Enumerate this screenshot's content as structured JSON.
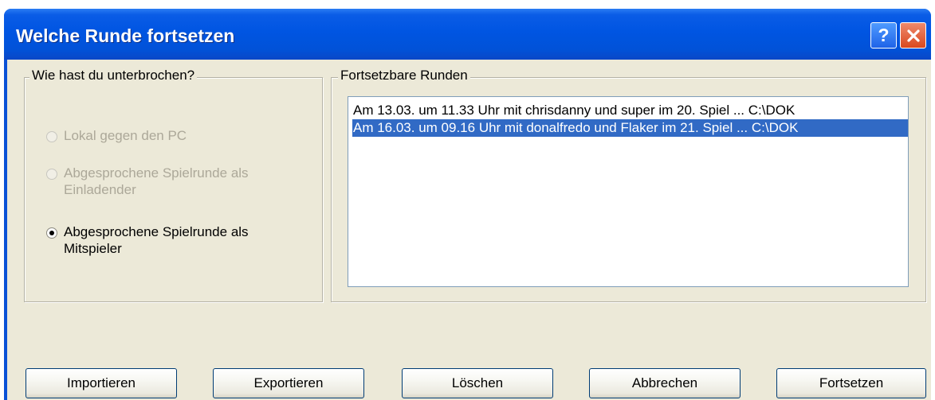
{
  "window": {
    "title": "Welche Runde fortsetzen"
  },
  "titlebar": {
    "help_label": "?",
    "close_label": "✕"
  },
  "interrupt_group": {
    "legend": "Wie hast du unterbrochen?",
    "options": [
      {
        "label": "Lokal gegen den PC",
        "enabled": false,
        "checked": false
      },
      {
        "label": "Abgesprochene Spielrunde als Einladender",
        "enabled": false,
        "checked": false
      },
      {
        "label": "Abgesprochene Spielrunde als Mitspieler",
        "enabled": true,
        "checked": true
      }
    ]
  },
  "rounds_group": {
    "legend": "Fortsetzbare Runden",
    "items": [
      {
        "text": "Am 13.03. um 11.33 Uhr mit chrisdanny und super im 20. Spiel ... C:\\DOK",
        "selected": false
      },
      {
        "text": "Am 16.03. um 09.16 Uhr mit donalfredo und Flaker im 21. Spiel ... C:\\DOK",
        "selected": true
      }
    ]
  },
  "buttons": {
    "import": "Importieren",
    "export": "Exportieren",
    "delete": "Löschen",
    "cancel": "Abbrechen",
    "continue": "Fortsetzen"
  },
  "colors": {
    "titlebar": "#0055e2",
    "dialog_bg": "#ece9d8",
    "selection": "#316ac5",
    "disabled_text": "#aca899"
  }
}
